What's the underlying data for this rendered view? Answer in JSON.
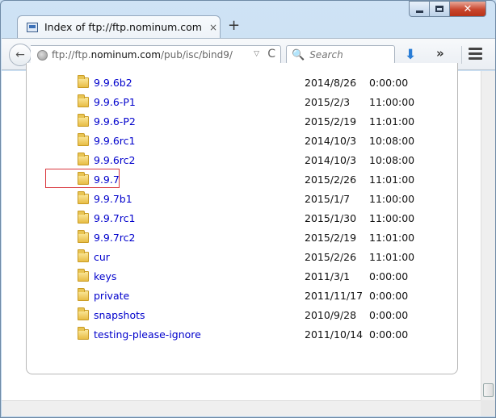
{
  "tab": {
    "title": "Index of ftp://ftp.nominum.com...",
    "close": "×",
    "new_tab": "+"
  },
  "window_controls": {
    "close": "✕"
  },
  "toolbar": {
    "back": "←",
    "url_prefix": "ftp://ftp.",
    "url_domain": "nominum.com",
    "url_suffix": "/pub/isc/bind9/",
    "dropdown": "▽",
    "reload": "C",
    "search_placeholder": "Search",
    "search_glyph": "🔍",
    "download": "⬇",
    "overflow": "»"
  },
  "listing": [
    {
      "name": "9.9.6b2",
      "date": "2014/8/26",
      "time": "0:00:00"
    },
    {
      "name": "9.9.6-P1",
      "date": "2015/2/3",
      "time": "11:00:00"
    },
    {
      "name": "9.9.6-P2",
      "date": "2015/2/19",
      "time": "11:01:00"
    },
    {
      "name": "9.9.6rc1",
      "date": "2014/10/3",
      "time": "10:08:00"
    },
    {
      "name": "9.9.6rc2",
      "date": "2014/10/3",
      "time": "10:08:00"
    },
    {
      "name": "9.9.7",
      "date": "2015/2/26",
      "time": "11:01:00"
    },
    {
      "name": "9.9.7b1",
      "date": "2015/1/7",
      "time": "11:00:00"
    },
    {
      "name": "9.9.7rc1",
      "date": "2015/1/30",
      "time": "11:00:00"
    },
    {
      "name": "9.9.7rc2",
      "date": "2015/2/19",
      "time": "11:01:00"
    },
    {
      "name": "cur",
      "date": "2015/2/26",
      "time": "11:01:00"
    },
    {
      "name": "keys",
      "date": "2011/3/1",
      "time": "0:00:00"
    },
    {
      "name": "private",
      "date": "2011/11/17",
      "time": "0:00:00"
    },
    {
      "name": "snapshots",
      "date": "2010/9/28",
      "time": "0:00:00"
    },
    {
      "name": "testing-please-ignore",
      "date": "2011/10/14",
      "time": "0:00:00"
    }
  ],
  "colors": {
    "link": "#0000cc",
    "highlight": "#d9373d",
    "close_button": "#c8452d"
  }
}
